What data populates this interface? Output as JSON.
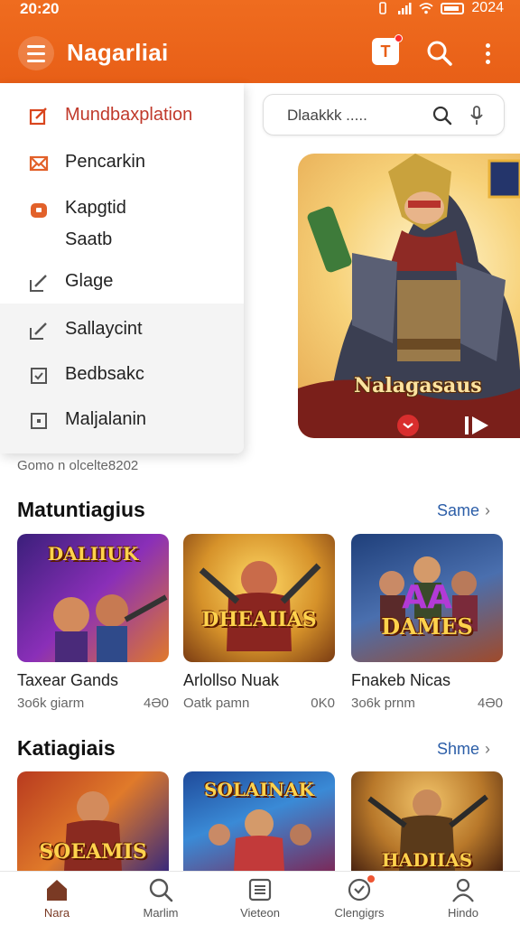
{
  "status_bar": {
    "time": "20:20",
    "battery_text": "2024"
  },
  "app_bar": {
    "title": "Nagarliai",
    "tv_label": "T"
  },
  "drawer": {
    "items": [
      {
        "label": "Mundbaxplation",
        "icon": "edit-icon",
        "active": true
      },
      {
        "label": "Pencarkin",
        "icon": "mail-icon"
      },
      {
        "label": "Kapgtid",
        "label2": "Saatb",
        "icon": "bag-icon"
      },
      {
        "label": "Glage",
        "icon": "pencil-icon"
      },
      {
        "label": "Sallaycint",
        "icon": "pencil-icon"
      },
      {
        "label": "Bedbsakc",
        "icon": "checkbox-icon"
      },
      {
        "label": "Maljalanin",
        "icon": "square-icon"
      }
    ],
    "credit": "Gomo n olcelte8202"
  },
  "search": {
    "placeholder": "Dlaakkk ....."
  },
  "banner": {
    "caption": "Nalagasaus"
  },
  "sections": [
    {
      "title": "Matuntiagius",
      "see_more": "Same",
      "cards": [
        {
          "name": "Taxear Gands",
          "sub": "3o6k giarm",
          "value": "4Ə0",
          "logo": "DALIIUK"
        },
        {
          "name": "Arlollso Nuak",
          "sub": "Oatk pamn",
          "value": "0K0",
          "logo": "DHEAIIAS"
        },
        {
          "name": "Fnakeb Nicas",
          "sub": "3o6k prnm",
          "value": "4Ə0",
          "logo": "DAMES"
        }
      ]
    },
    {
      "title": "Katiagiais",
      "see_more": "Shme",
      "cards": [
        {
          "logo": "SOEAMIS"
        },
        {
          "logo": "SOLAINAK"
        },
        {
          "logo": "HADIIAS"
        }
      ]
    }
  ],
  "bottom_nav": [
    {
      "label": "Nara",
      "icon": "home-icon",
      "active": true
    },
    {
      "label": "Marlim",
      "icon": "search-icon"
    },
    {
      "label": "Vieteon",
      "icon": "list-icon"
    },
    {
      "label": "Clengigrs",
      "icon": "heart-badge-icon"
    },
    {
      "label": "Hindo",
      "icon": "profile-icon"
    }
  ],
  "colors": {
    "brand": "#e85f17",
    "active_menu": "#c0392b",
    "link": "#2c5ea8"
  }
}
